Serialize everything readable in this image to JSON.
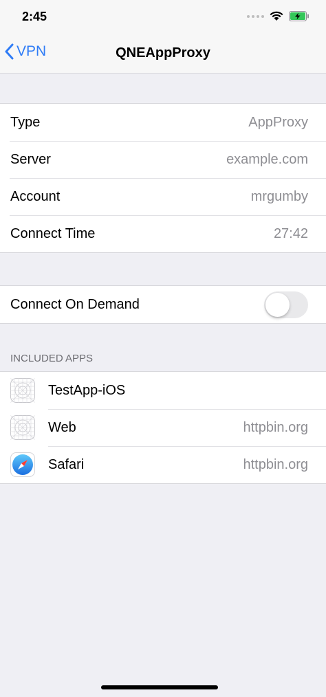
{
  "status_bar": {
    "time": "2:45"
  },
  "nav": {
    "back_label": "VPN",
    "title": "QNEAppProxy"
  },
  "info": [
    {
      "label": "Type",
      "value": "AppProxy"
    },
    {
      "label": "Server",
      "value": "example.com"
    },
    {
      "label": "Account",
      "value": "mrgumby"
    },
    {
      "label": "Connect Time",
      "value": "27:42"
    }
  ],
  "on_demand": {
    "label": "Connect On Demand",
    "enabled": false
  },
  "included_apps": {
    "header": "INCLUDED APPS",
    "items": [
      {
        "name": "TestApp-iOS",
        "value": "",
        "icon": "placeholder-app-icon"
      },
      {
        "name": "Web",
        "value": "httpbin.org",
        "icon": "placeholder-app-icon"
      },
      {
        "name": "Safari",
        "value": "httpbin.org",
        "icon": "safari-icon"
      }
    ]
  },
  "colors": {
    "accent": "#2f7cf6",
    "background": "#efeff4",
    "secondary_text": "#8e8e93"
  }
}
